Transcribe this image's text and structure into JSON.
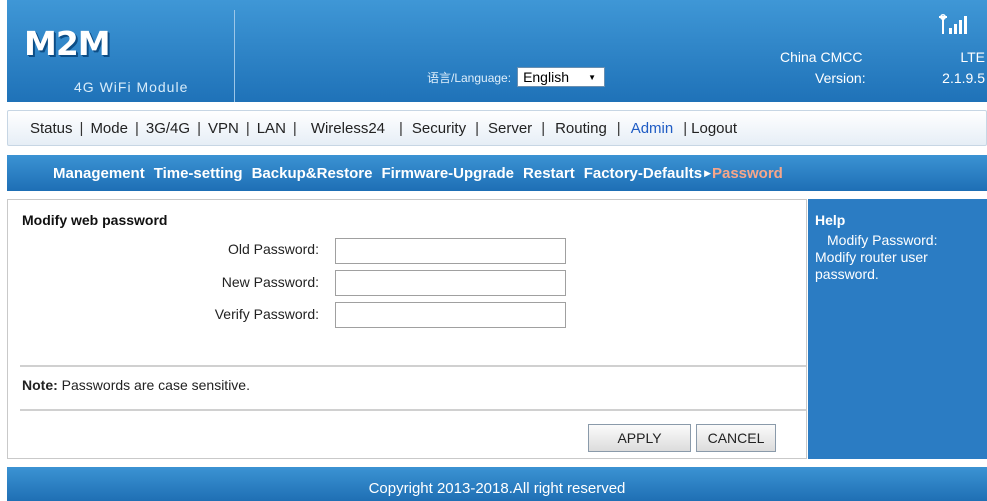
{
  "header": {
    "logo": "M2M",
    "subtitle": "4G WiFi Module",
    "language_label": "语言/Language:",
    "language_selected": "English",
    "carrier_label": "China CMCC",
    "network": "LTE",
    "version_label": "Version:",
    "version_value": "2.1.9.5"
  },
  "nav": {
    "items": [
      "Status",
      "Mode",
      "3G/4G",
      "VPN",
      "LAN",
      "Wireless24",
      "Security",
      "Server",
      "Routing",
      "Admin",
      "Logout"
    ],
    "active": "Admin"
  },
  "subnav": {
    "items": [
      "Management",
      "Time-setting",
      "Backup&Restore",
      "Firmware-Upgrade",
      "Restart",
      "Factory-Defaults",
      "Password"
    ],
    "current": "Password"
  },
  "form": {
    "title": "Modify web password",
    "old_label": "Old Password:",
    "old_value": "",
    "new_label": "New Password:",
    "new_value": "",
    "verify_label": "Verify Password:",
    "verify_value": "",
    "note_bold": "Note:",
    "note_text": " Passwords are case sensitive.",
    "apply_label": "APPLY",
    "cancel_label": "CANCEL"
  },
  "help": {
    "title": "Help",
    "text": "Modify Password: Modify router user password."
  },
  "footer": {
    "copyright": "Copyright 2013-2018.All right reserved"
  },
  "colors": {
    "header_blue": "#1f72b8",
    "active_nav": "#1f5cc4",
    "current_subnav": "#f7a68a",
    "help_panel": "#2b7cc3"
  },
  "icons": {
    "signal": "signal-bars-icon",
    "dropdown": "chevron-down-icon",
    "subnav_arrow": "arrow-right-icon"
  }
}
